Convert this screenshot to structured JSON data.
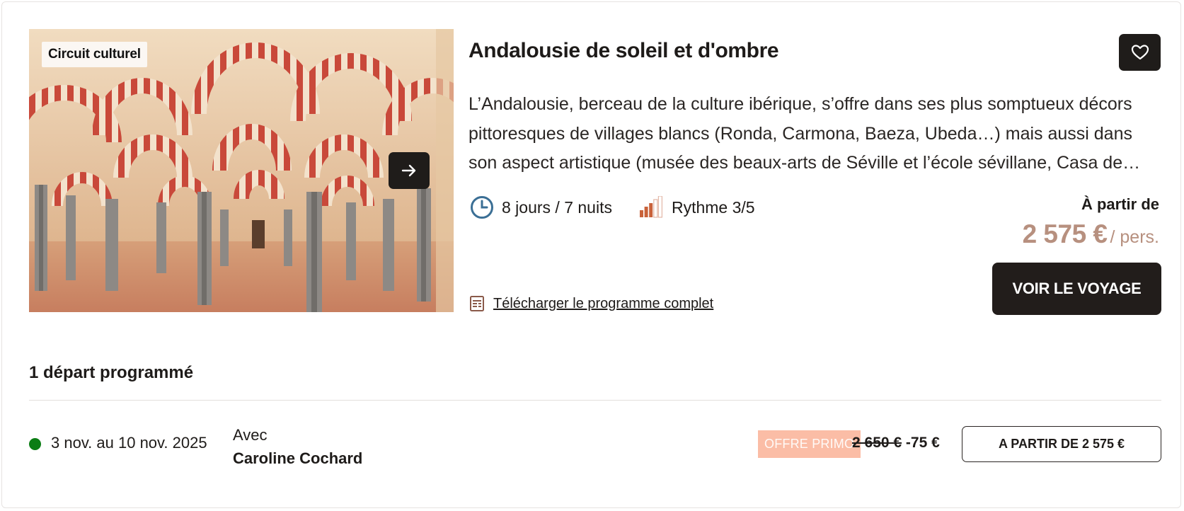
{
  "card": {
    "tag": "Circuit culturel",
    "title": "Andalousie de soleil et d'ombre",
    "description": "L’Andalousie, berceau de la culture ibérique, s’offre dans ses plus somptueux décors pittoresques de villages blancs (Ronda, Carmona, Baeza, Ubeda…) mais aussi dans son aspect artistique (musée des beaux-arts de Séville et l’école sévillane, Casa de Pilatos…",
    "duration": "8 jours / 7 nuits",
    "rhythm": "Rythme 3/5",
    "rhythm_level": 3,
    "rhythm_max": 5,
    "download_label": "Télécharger le programme complet",
    "from_label": "À partir de",
    "price": "2 575 €",
    "per": "/ pers.",
    "cta_label": "VOIR LE VOYAGE",
    "icons": {
      "next": "arrow-right-icon",
      "favorite": "heart-icon",
      "duration": "clock-icon",
      "rhythm": "rhythm-bars-icon",
      "download": "document-icon"
    }
  },
  "departures": {
    "title": "1 départ programmé",
    "items": [
      {
        "dates": "3 nov. au 10 nov. 2025",
        "status_color": "#0b7d14",
        "guide_prefix": "Avec",
        "guide_name": "Caroline Cochard",
        "promo": "OFFRE PRIMO",
        "old_price": "2 650 €",
        "discount": "-75 €",
        "cta_label": "A PARTIR DE 2 575 €"
      }
    ]
  },
  "colors": {
    "accent_price": "#b7907f",
    "dark": "#221d1b",
    "promo_bg": "#fbbda6",
    "rhythm_active": "#c9623a",
    "clock": "#3b6f95"
  }
}
